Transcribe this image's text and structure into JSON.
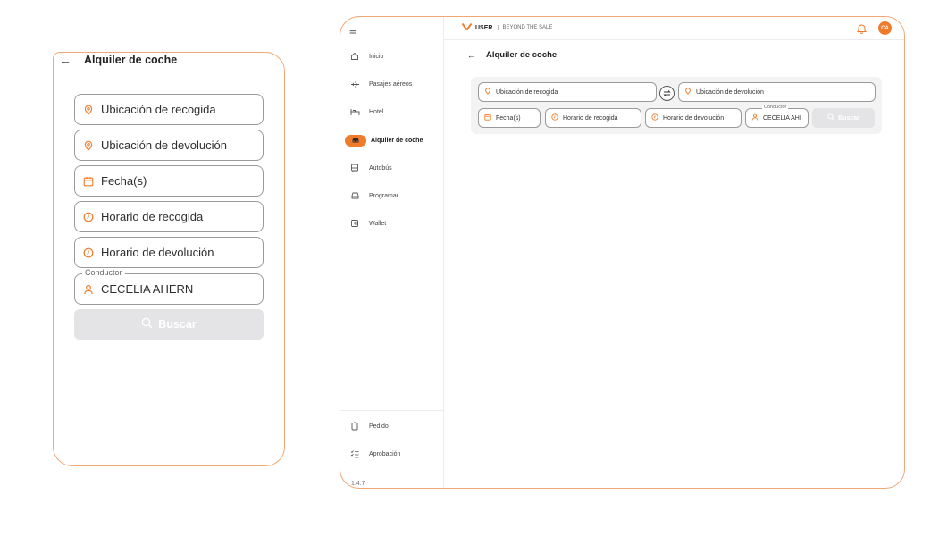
{
  "mobile": {
    "back_icon": "arrow-left-icon",
    "title": "Alquiler de coche",
    "fields": {
      "pickup": "Ubicación de recogida",
      "dropoff": "Ubicación de devolución",
      "dates": "Fecha(s)",
      "pickup_time": "Horario de recogida",
      "dropoff_time": "Horario de devolución",
      "driver_label": "Conductor",
      "driver_value": "CECELIA AHERN"
    },
    "search_button": "Buscar"
  },
  "desktop": {
    "sidebar": {
      "items": [
        {
          "label": "Inicio",
          "icon": "home-icon"
        },
        {
          "label": "Pasajes aéreos",
          "icon": "plane-icon"
        },
        {
          "label": "Hotel",
          "icon": "bed-icon"
        },
        {
          "label": "Alquiler de coche",
          "icon": "car-icon",
          "active": true
        },
        {
          "label": "Autobús",
          "icon": "bus-icon"
        },
        {
          "label": "Programar",
          "icon": "calendar-car-icon"
        },
        {
          "label": "Wallet",
          "icon": "wallet-icon"
        }
      ],
      "bottom_items": [
        {
          "label": "Pedido",
          "icon": "order-icon"
        },
        {
          "label": "Aprobación",
          "icon": "checklist-icon"
        }
      ],
      "version": "1.4.7"
    },
    "topbar": {
      "brand": "USER",
      "tagline": "BEYOND THE SALE",
      "avatar_initials": "CA"
    },
    "title": "Alquiler de coche",
    "fields": {
      "pickup": "Ubicación de recogida",
      "dropoff": "Ubicación de devolución",
      "dates": "Fecha(s)",
      "pickup_time": "Horario de recogida",
      "dropoff_time": "Horario de devolución",
      "driver_label": "Conductor",
      "driver_value": "CECELIA AHI"
    },
    "search_button": "Buscar"
  },
  "colors": {
    "accent": "#f07b2b",
    "border": "#9a9a9a",
    "disabled": "#e4e4e6"
  }
}
